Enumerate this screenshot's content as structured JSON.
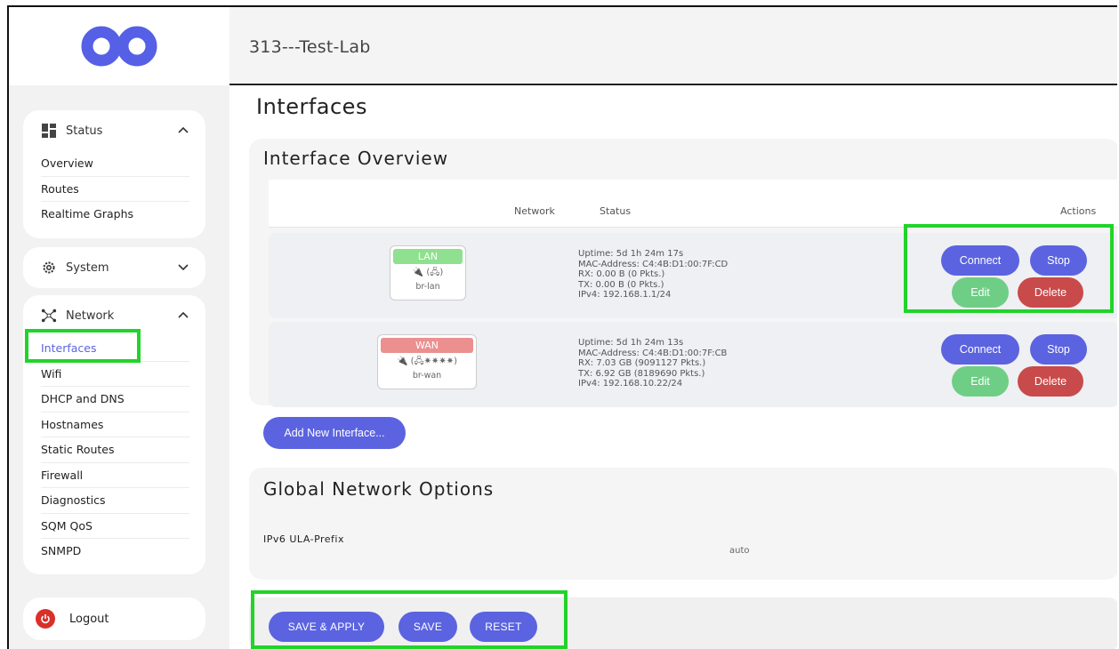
{
  "app": {
    "title": "313---Test-Lab"
  },
  "sidebar": {
    "status": {
      "label": "Status",
      "items": [
        "Overview",
        "Routes",
        "Realtime Graphs"
      ]
    },
    "system": {
      "label": "System"
    },
    "network": {
      "label": "Network",
      "items": [
        "Interfaces",
        "Wifi",
        "DHCP and DNS",
        "Hostnames",
        "Static Routes",
        "Firewall",
        "Diagnostics",
        "SQM QoS",
        "SNMPD"
      ]
    },
    "logout": "Logout"
  },
  "page": {
    "title": "Interfaces",
    "overview_title": "Interface Overview",
    "columns": {
      "network": "Network",
      "status": "Status",
      "actions": "Actions"
    },
    "interfaces": [
      {
        "name": "LAN",
        "ports": "🔌 (🖧)",
        "device": "br-lan",
        "badge_color": "#8fe08f",
        "status": [
          "Uptime: 5d 1h 24m 17s",
          "MAC-Address: C4:4B:D1:00:7F:CD",
          "RX: 0.00 B (0 Pkts.)",
          "TX: 0.00 B (0 Pkts.)",
          "IPv4: 192.168.1.1/24"
        ]
      },
      {
        "name": "WAN",
        "ports": "🔌 (🖧✷✷✷✷)",
        "device": "br-wan",
        "badge_color": "#ec8f8f",
        "status": [
          "Uptime: 5d 1h 24m 13s",
          "MAC-Address: C4:4B:D1:00:7F:CB",
          "RX: 7.03 GB (9091127 Pkts.)",
          "TX: 6.92 GB (8189690 Pkts.)",
          "IPv4: 192.168.10.22/24"
        ]
      }
    ],
    "actions": {
      "connect": "Connect",
      "stop": "Stop",
      "edit": "Edit",
      "delete": "Delete"
    },
    "add_interface": "Add New Interface...",
    "global_title": "Global Network Options",
    "ula_label": "IPv6 ULA-Prefix",
    "ula_value": "auto",
    "footer": {
      "save_apply": "SAVE & APPLY",
      "save": "SAVE",
      "reset": "RESET"
    }
  },
  "colors": {
    "accent": "#5b63e0",
    "edit": "#6fce85",
    "delete": "#c94a4a",
    "highlight": "#22d32a"
  }
}
